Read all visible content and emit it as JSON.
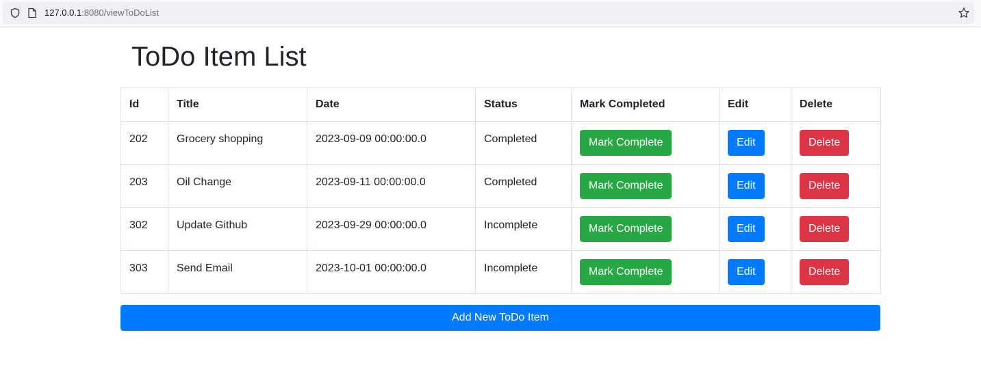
{
  "browser": {
    "url_host": "127.0.0.1",
    "url_path": ":8080/viewToDoList"
  },
  "page": {
    "title": "ToDo Item List",
    "add_button_label": "Add New ToDo Item"
  },
  "table": {
    "headers": {
      "id": "Id",
      "title": "Title",
      "date": "Date",
      "status": "Status",
      "mark": "Mark Completed",
      "edit": "Edit",
      "delete": "Delete"
    },
    "rows": [
      {
        "id": "202",
        "title": "Grocery shopping",
        "date": "2023-09-09 00:00:00.0",
        "status": "Completed",
        "mark_label": "Mark Complete",
        "edit_label": "Edit",
        "delete_label": "Delete"
      },
      {
        "id": "203",
        "title": "Oil Change",
        "date": "2023-09-11 00:00:00.0",
        "status": "Completed",
        "mark_label": "Mark Complete",
        "edit_label": "Edit",
        "delete_label": "Delete"
      },
      {
        "id": "302",
        "title": "Update Github",
        "date": "2023-09-29 00:00:00.0",
        "status": "Incomplete",
        "mark_label": "Mark Complete",
        "edit_label": "Edit",
        "delete_label": "Delete"
      },
      {
        "id": "303",
        "title": "Send Email",
        "date": "2023-10-01 00:00:00.0",
        "status": "Incomplete",
        "mark_label": "Mark Complete",
        "edit_label": "Edit",
        "delete_label": "Delete"
      }
    ]
  },
  "colors": {
    "success": "#28a745",
    "primary": "#007bff",
    "danger": "#dc3545"
  },
  "icons": {
    "tracking_protection": "shield-icon",
    "page_info": "page-icon",
    "bookmark": "star-icon"
  }
}
